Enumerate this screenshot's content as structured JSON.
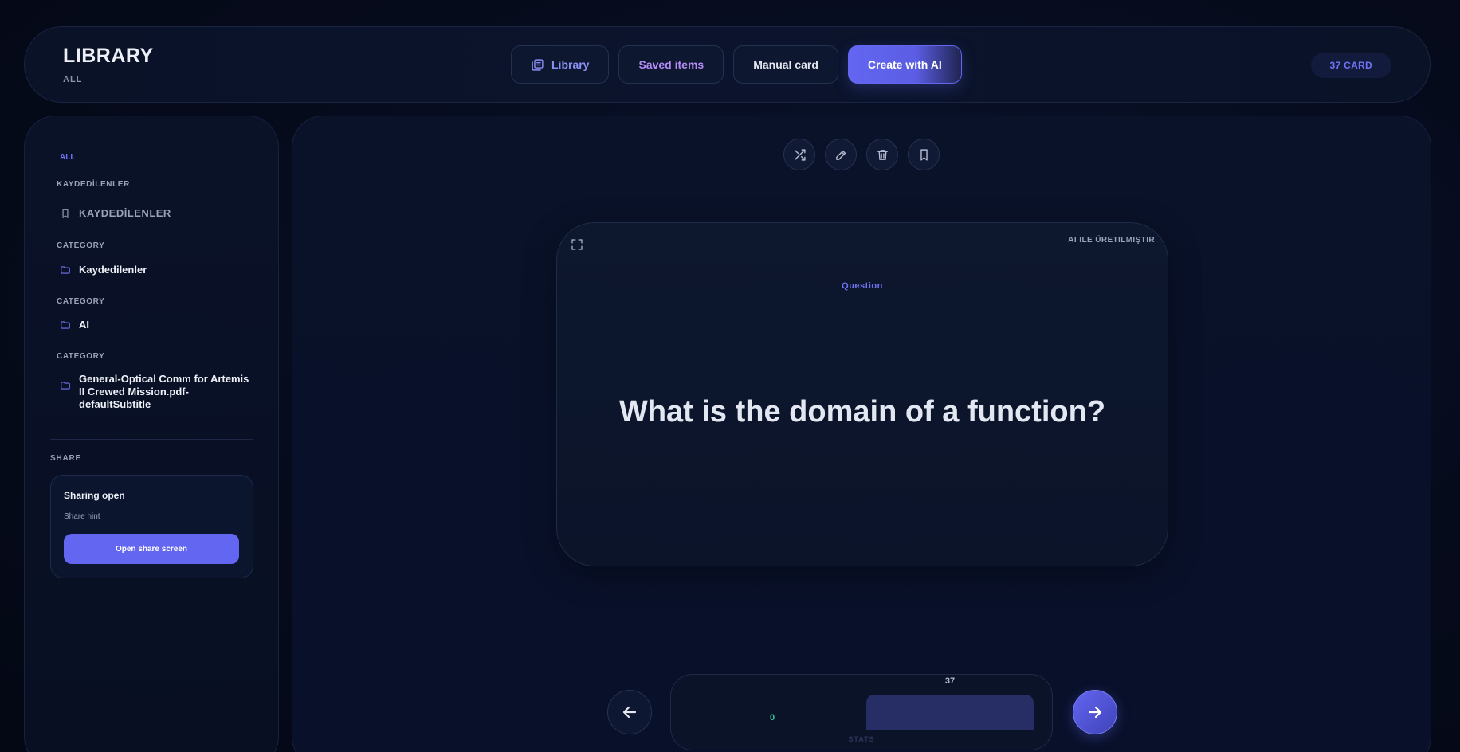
{
  "header": {
    "title": "LIBRARY",
    "subtitle": "ALL",
    "nav": {
      "library": "Library",
      "saved": "Saved items",
      "manual": "Manual card",
      "ai": "Create with AI"
    },
    "card_count": "37 CARD"
  },
  "sidebar": {
    "all": "ALL",
    "groups": [
      {
        "section": "KAYDEDİLENLER",
        "item": "KAYDEDİLENLER",
        "icon": "bookmark-icon"
      },
      {
        "section": "CATEGORY",
        "item": "Kaydedilenler",
        "icon": "folder-icon"
      },
      {
        "section": "CATEGORY",
        "item": "AI",
        "icon": "folder-icon"
      },
      {
        "section": "CATEGORY",
        "item": "General-Optical Comm for Artemis II Crewed Mission.pdf-defaultSubtitle",
        "icon": "folder-icon"
      }
    ],
    "share": {
      "label": "SHARE",
      "title": "Sharing open",
      "hint": "Share hint",
      "button": "Open share screen"
    }
  },
  "card": {
    "badge": "AI ILE ÜRETILMIŞTIR",
    "label": "Question",
    "question": "What is the domain of a function?"
  },
  "stats": {
    "zero_value": "0",
    "bar_value": "37",
    "bar_fill_fraction": 0.7,
    "caption": "STATS"
  },
  "colors": {
    "accent": "#6366f1",
    "success": "#34c99a",
    "saved_accent": "#b38cf5"
  }
}
